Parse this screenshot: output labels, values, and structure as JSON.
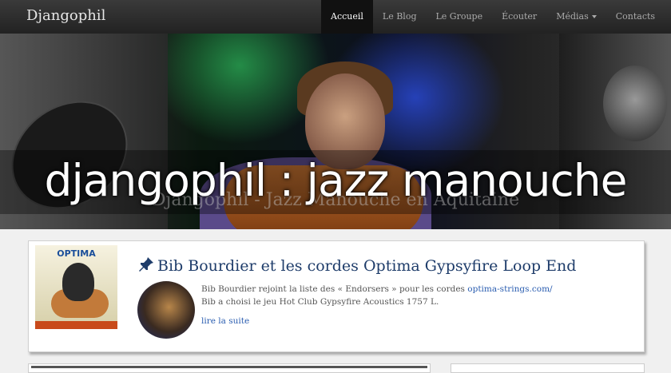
{
  "navbar": {
    "brand": "Djangophil",
    "items": [
      {
        "label": "Accueil"
      },
      {
        "label": "Le Blog"
      },
      {
        "label": "Le Groupe"
      },
      {
        "label": "Écouter"
      },
      {
        "label": "Médias"
      },
      {
        "label": "Contacts"
      }
    ]
  },
  "hero": {
    "title": "djangophil : jazz manouche",
    "subtitle": "Djangophil - Jazz Manouche en Aquitaine"
  },
  "post": {
    "thumb_brand": "OPTIMA",
    "title": "Bib Bourdier et les cordes Optima Gypsyfire Loop End",
    "text_line1": "Bib Bourdier rejoint la  liste des « Endorsers » pour les cordes ",
    "text_link": "optima-strings.com/",
    "text_line2": "Bib a choisi le jeu Hot Club Gypsyfire Acoustics 1757 L.",
    "read_more": "lire la suite"
  },
  "colors": {
    "navbar_bg": "#222222",
    "title_color": "#1e3c6a",
    "link_color": "#2a5db0"
  }
}
